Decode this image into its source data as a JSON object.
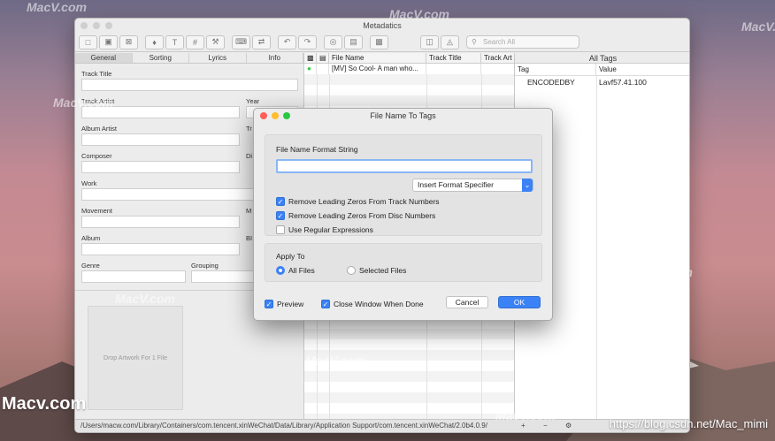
{
  "window": {
    "title": "Metadatics",
    "search_placeholder": "Search All"
  },
  "toolbar_icons": [
    "file-icon",
    "file-save-icon",
    "file-close-icon",
    "tag-icon",
    "text-icon",
    "number-icon",
    "tools-icon",
    "keyboard-icon",
    "doc-convert-icon",
    "undo-icon",
    "redo-icon",
    "globe-icon",
    "picture-icon",
    "save-icon",
    "sidebar-left-icon",
    "sidebar-right-icon"
  ],
  "tabs": [
    "General",
    "Sorting",
    "Lyrics",
    "Info"
  ],
  "fields": {
    "track_title": "Track Title",
    "track_artist": "Track Artist",
    "year": "Year",
    "album_artist": "Album Artist",
    "composer": "Composer",
    "work": "Work",
    "movement": "Movement",
    "album": "Album",
    "genre": "Genre",
    "grouping": "Grouping",
    "tr": "Tr",
    "di": "Di",
    "m": "M",
    "bi": "BI"
  },
  "artwork_label": "Drop Artwork For 1 File",
  "file_list": {
    "columns": [
      "File Name",
      "Track Title",
      "Track Art"
    ],
    "rows": [
      {
        "name": "[MV] So Cool- A man who...",
        "title": "",
        "artist": ""
      }
    ]
  },
  "all_tags": {
    "header": "All Tags",
    "columns": [
      "Tag",
      "Value"
    ],
    "rows": [
      {
        "tag": "ENCODEDBY",
        "value": "Lavf57.41.100"
      }
    ]
  },
  "status_path": "/Users/macw.com/Library/Containers/com.tencent.xinWeChat/Data/Library/Application Support/com.tencent.xinWeChat/2.0b4.0.9/",
  "dialog": {
    "title": "File Name To Tags",
    "format_label": "File Name Format String",
    "format_value": "",
    "insert_specifier": "Insert Format Specifier",
    "options": [
      {
        "label": "Remove Leading Zeros From Track Numbers",
        "checked": true
      },
      {
        "label": "Remove Leading Zeros From Disc Numbers",
        "checked": true
      },
      {
        "label": "Use Regular Expressions",
        "checked": false
      }
    ],
    "apply_to_label": "Apply To",
    "apply_options": [
      "All Files",
      "Selected Files"
    ],
    "preview_label": "Preview",
    "close_when_done_label": "Close Window When Done",
    "cancel_label": "Cancel",
    "ok_label": "OK"
  },
  "watermarks": {
    "brand": "MacV.com",
    "footer_left": "Macv.com",
    "footer_right": "https://blog.csdn.net/Mac_mimi"
  },
  "colors": {
    "accent": "#3b82f6",
    "green_dot": "#2ecc40"
  }
}
